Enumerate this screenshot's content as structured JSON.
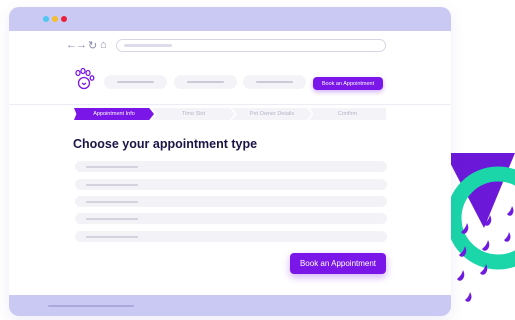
{
  "app": {
    "title": "Book an Appointment"
  },
  "colors": {
    "accent": "#7b16e8",
    "window_frame": "#c9c9f3",
    "heading": "#1c1446",
    "deco_teal": "#1ad6a9",
    "deco_purple": "#6b18d8",
    "traffic_light_blue": "#4fc7f2",
    "traffic_light_yellow": "#f6bd2d",
    "traffic_light_red": "#ea1f3a"
  },
  "browser": {
    "back_icon": "←",
    "forward_icon": "→",
    "reload_icon": "↻",
    "home_icon": "⌂"
  },
  "header": {
    "logo_icon": "paw-icon",
    "cta_label": "Book an Appointment"
  },
  "steps": [
    {
      "label": "Appointment Info",
      "active": true
    },
    {
      "label": "Time Slot",
      "active": false
    },
    {
      "label": "Pet Owner Details",
      "active": false
    },
    {
      "label": "Confirm",
      "active": false
    }
  ],
  "main": {
    "heading": "Choose your appointment type",
    "submit_label": "Book an Appointment"
  }
}
